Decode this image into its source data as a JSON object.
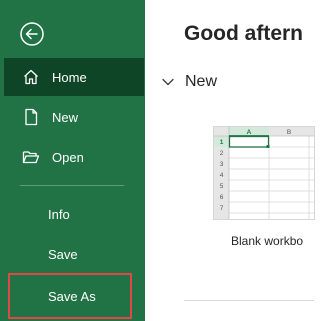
{
  "sidebar": {
    "back_icon": "back-arrow-icon",
    "items": [
      {
        "label": "Home",
        "icon": "home-icon",
        "active": true
      },
      {
        "label": "New",
        "icon": "new-document-icon"
      },
      {
        "label": "Open",
        "icon": "folder-open-icon"
      },
      {
        "label": "Info"
      },
      {
        "label": "Save"
      },
      {
        "label": "Save As",
        "highlighted": true
      }
    ]
  },
  "main": {
    "greeting": "Good aftern",
    "section_title": "New",
    "template": {
      "caption": "Blank workbo",
      "col_headers": [
        "A",
        "B"
      ],
      "row_headers": [
        "1",
        "2",
        "3",
        "4",
        "5",
        "6",
        "7"
      ]
    }
  },
  "colors": {
    "sidebar_bg": "#217346",
    "active_item_bg": "#0f4527",
    "highlight_border": "#e04848",
    "excel_green": "#217346"
  }
}
